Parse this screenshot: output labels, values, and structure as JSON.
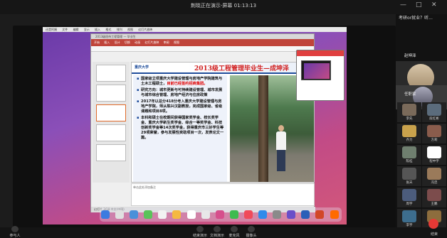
{
  "window": {
    "title": "荆晓正在演示-屏幕 01:13:13"
  },
  "mac_menu": [
    "还是阿姨",
    "文件",
    "编辑",
    "显示",
    "插入",
    "格式",
    "排列",
    "视图",
    "幻灯片放映"
  ],
  "ppt": {
    "filename": "2013级屈伟工程管理 — 毕业生",
    "ribbon_tabs": [
      "开始",
      "插入",
      "设计",
      "切换",
      "动画",
      "幻灯片放映",
      "审阅",
      "视图"
    ],
    "notes_placeholder": "单击此处添加备注",
    "status": "幻灯片 3/18  中文(中国)"
  },
  "slide": {
    "logo_text": "重庆大学",
    "title": "2013级工程管理毕业生—成坤泽",
    "bullets": [
      {
        "text": "国家级立项重庆大学建设管理与房地产学院建筑与土木工程硕士，",
        "highlight": "目前已经签约招商集团。"
      },
      {
        "text": "研究方向：城市更新与可持续建设管理、城市发展与城市综合管理、房地产经济与住房政策",
        "highlight": ""
      },
      {
        "text": "2017年以总分418分考入重庆大学建设管理与房地产学院，师从陈兴汉副教授，完成国家级、省级课题和项目8项。",
        "highlight": ""
      },
      {
        "text": "本科和硕士在校期间获得国家奖学金、校长奖学金、重庆大学新生奖学金、综合一等奖学金、科技创新奖学金等14次奖学金，获得重庆市三好学生等29项荣誉，参与发展性资助项目一次，发表论文一篇。",
        "highlight": ""
      }
    ]
  },
  "sidebar": {
    "tab_label": "考研or就业？听...",
    "host_name": "赵坤泽",
    "host2_name": "任职家",
    "participants": [
      {
        "name": "李先",
        "color": "#7a6a5a"
      },
      {
        "name": "段红彬",
        "color": "#5b6c7c"
      },
      {
        "name": "齐力",
        "color": "#c9a24c"
      },
      {
        "name": "方莉",
        "color": "#8a5c4c"
      },
      {
        "name": "陈桂",
        "color": "#6f7f6f"
      },
      {
        "name": "程中宇",
        "color": "#ffffff"
      },
      {
        "name": "张天",
        "color": "#555555"
      },
      {
        "name": "冯忠",
        "color": "#9a7a5a"
      },
      {
        "name": "周宇",
        "color": "#4c5c7c"
      },
      {
        "name": "王鹏",
        "color": "#7c4c4c"
      },
      {
        "name": "李字",
        "color": "#3d6d8d"
      },
      {
        "name": "伊方",
        "color": "#8d6d3d"
      }
    ]
  },
  "bottombar": {
    "left": "参与人",
    "buttons": [
      "结束演示",
      "文档演示",
      "麦克风",
      "摄像头"
    ],
    "right": "结束"
  },
  "colors": {
    "accent": "#1e4c9a",
    "highlight": "#e00000",
    "leave": "#e53935"
  }
}
